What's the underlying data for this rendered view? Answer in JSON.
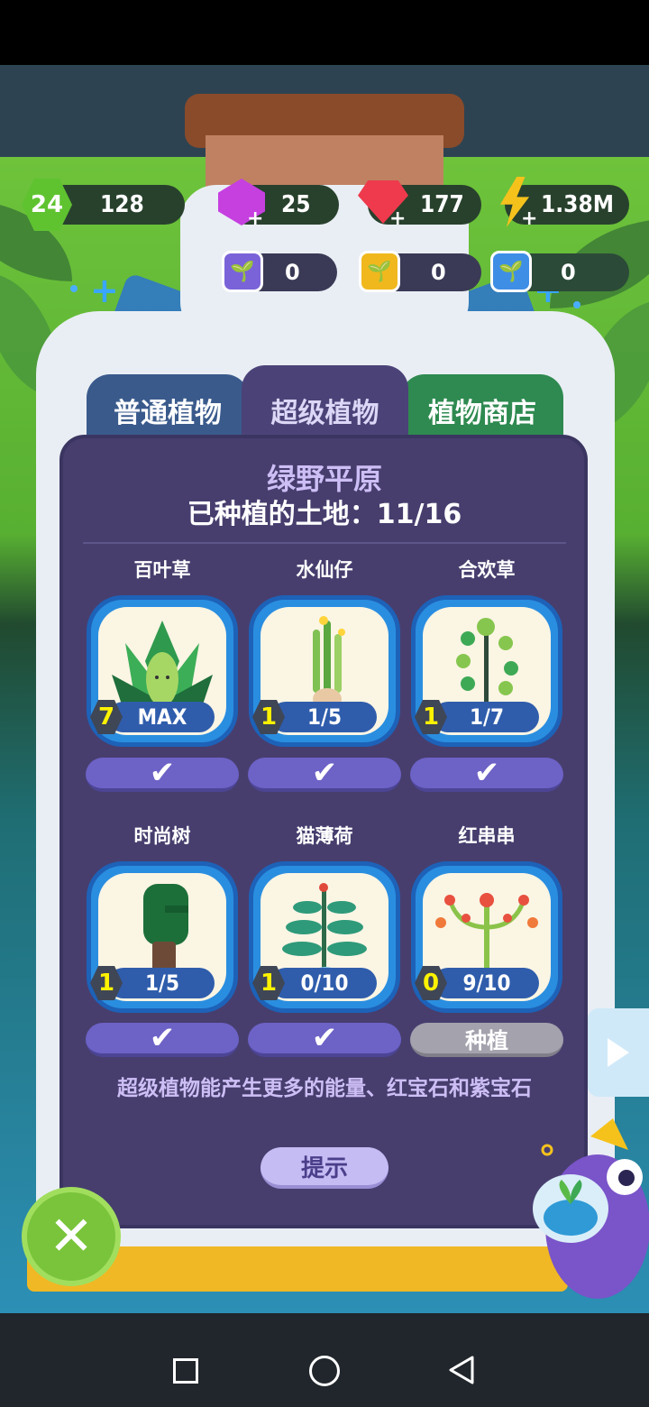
{
  "resources": {
    "level": "24",
    "exp": "128",
    "purple_gems": "25",
    "red_gems": "177",
    "energy": "1.38M"
  },
  "seeds": [
    {
      "color": "purple",
      "value": "0"
    },
    {
      "color": "yellow",
      "value": "0"
    },
    {
      "color": "blue",
      "value": "0"
    }
  ],
  "tabs": {
    "normal": "普通植物",
    "super": "超级植物",
    "shop": "植物商店"
  },
  "region": {
    "title": "绿野平原",
    "land_label": "已种植的土地：11/16"
  },
  "plants": [
    {
      "name": "百叶草",
      "level": "7",
      "progress": "MAX",
      "action": "✔"
    },
    {
      "name": "水仙仔",
      "level": "1",
      "progress": "1/5",
      "action": "✔"
    },
    {
      "name": "合欢草",
      "level": "1",
      "progress": "1/7",
      "action": "✔"
    },
    {
      "name": "时尚树",
      "level": "1",
      "progress": "1/5",
      "action": "✔"
    },
    {
      "name": "猫薄荷",
      "level": "1",
      "progress": "0/10",
      "action": "✔"
    },
    {
      "name": "红串串",
      "level": "0",
      "progress": "9/10",
      "action": "种植"
    }
  ],
  "description": "超级植物能产生更多的能量、红宝石和紫宝石",
  "hint_button": "提示",
  "close_icon": "close-icon",
  "next_icon": "arrow-right-icon"
}
